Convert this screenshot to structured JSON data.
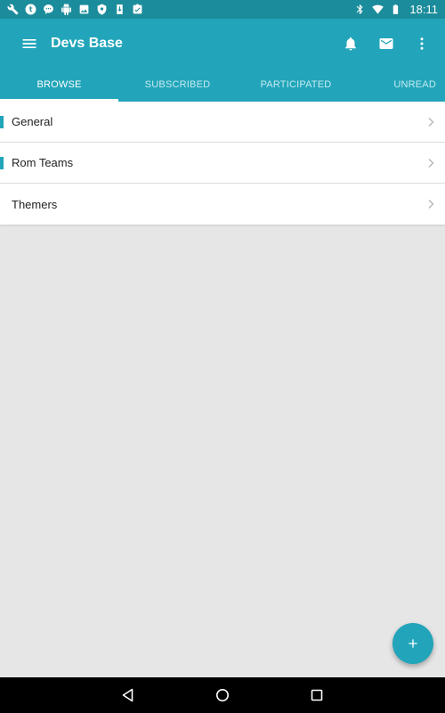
{
  "status_bar": {
    "time": "18:11",
    "left_icons": [
      "wrench-icon",
      "tumblr-icon",
      "chat-bubble-icon",
      "android-icon",
      "image-icon",
      "shield-icon",
      "download-icon",
      "clipboard-icon"
    ],
    "right_icons": [
      "bluetooth-icon",
      "wifi-icon",
      "battery-icon"
    ]
  },
  "app_bar": {
    "title": "Devs Base",
    "actions": [
      "bell-icon",
      "mail-icon",
      "more-vert-icon"
    ]
  },
  "tabs": [
    {
      "label": "BROWSE",
      "active": true
    },
    {
      "label": "SUBSCRIBED",
      "active": false
    },
    {
      "label": "PARTICIPATED",
      "active": false
    },
    {
      "label": "UNREAD",
      "active": false
    }
  ],
  "forums": [
    {
      "label": "General",
      "has_accent": true
    },
    {
      "label": "Rom Teams",
      "has_accent": true
    },
    {
      "label": "Themers",
      "has_accent": false
    }
  ],
  "fab": {
    "icon": "plus-icon"
  },
  "nav_bar": {
    "buttons": [
      "back-icon",
      "home-icon",
      "recents-icon"
    ]
  },
  "colors": {
    "status_bar": "#1b8c9b",
    "primary": "#22a5ba",
    "background": "#e6e6e6",
    "nav_bar": "#000000"
  }
}
